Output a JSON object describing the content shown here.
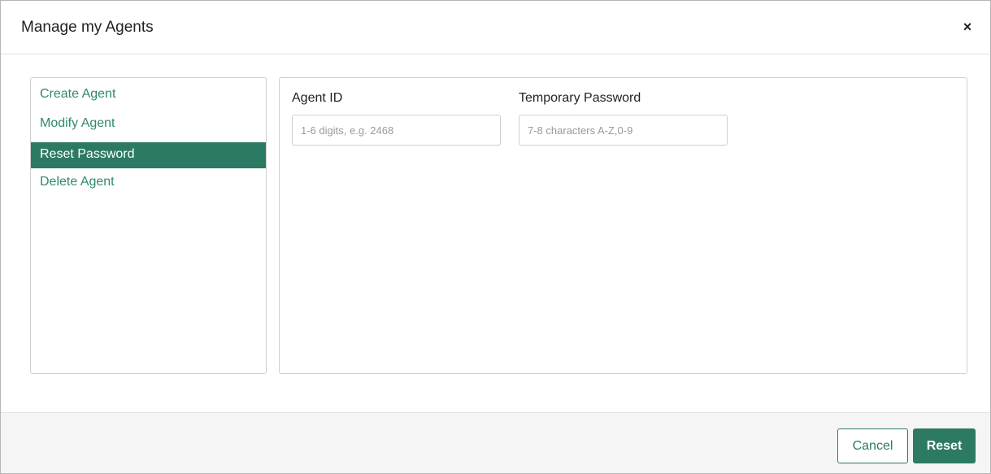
{
  "dialog": {
    "title": "Manage my Agents",
    "close_symbol": "×",
    "close_icon": "close-icon"
  },
  "menu": {
    "items": [
      {
        "label": "Create Agent",
        "active": false
      },
      {
        "label": "Modify Agent",
        "active": false
      },
      {
        "label": "Reset Password",
        "active": true
      },
      {
        "label": "Delete Agent",
        "active": false
      }
    ]
  },
  "form": {
    "agent_id": {
      "label": "Agent ID",
      "value": "",
      "placeholder": "1-6 digits, e.g. 2468"
    },
    "temp_password": {
      "label": "Temporary Password",
      "value": "",
      "placeholder": "7-8 characters A-Z,0-9"
    }
  },
  "footer": {
    "cancel_label": "Cancel",
    "reset_label": "Reset"
  },
  "colors": {
    "accent": "#2c7a63",
    "link": "#2f8a6a",
    "footer_bg": "#f5f5f5"
  }
}
